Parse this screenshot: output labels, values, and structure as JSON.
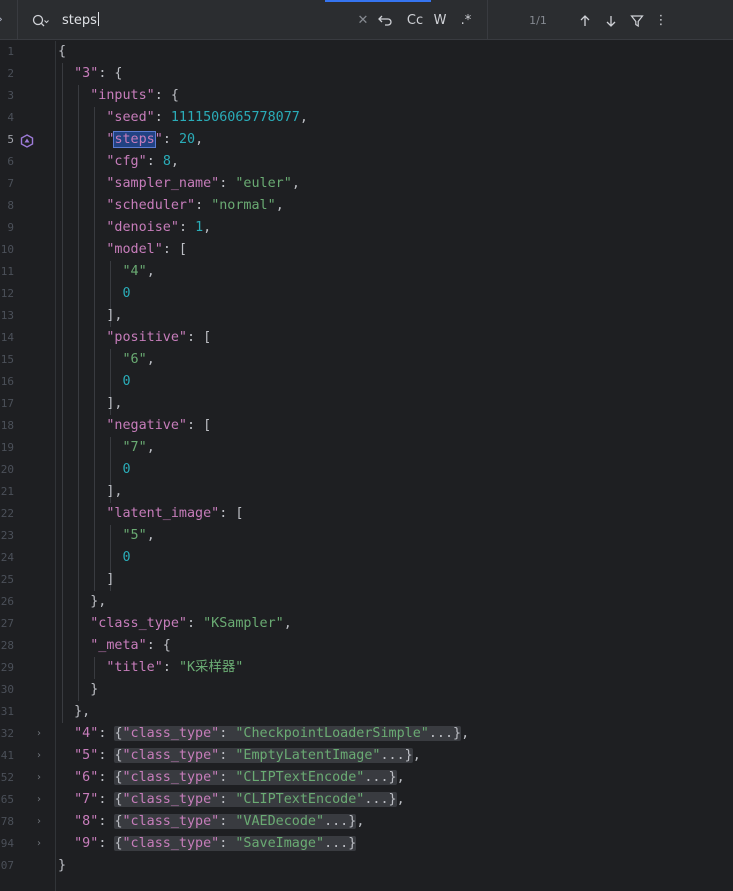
{
  "search": {
    "query": "steps",
    "case_label": "Cc",
    "word_label": "W",
    "regex_label": ".*",
    "result_count": "1/1",
    "icons": [
      "chevron-right-icon",
      "search-history-icon",
      "clear-icon",
      "replace-toggle-icon",
      "arrow-up-icon",
      "arrow-down-icon",
      "filter-icon",
      "more-options-icon"
    ]
  },
  "editor": {
    "lines": [
      {
        "n": "1",
        "fold": "",
        "html": "<span class='p'>{</span>"
      },
      {
        "n": "2",
        "fold": "",
        "html": "  <span class='k'>\"3\"</span><span class='p'>: {</span>"
      },
      {
        "n": "3",
        "fold": "",
        "html": "    <span class='k'>\"inputs\"</span><span class='p'>: {</span>"
      },
      {
        "n": "4",
        "fold": "",
        "html": "      <span class='k'>\"seed\"</span><span class='p'>: </span><span class='n'>1111506065778077</span><span class='p'>,</span>"
      },
      {
        "n": "5",
        "fold": "",
        "html": "      <span class='k'>\"<span class='hl'>steps</span>\"</span><span class='p'>: </span><span class='n'>20</span><span class='p'>,</span>",
        "current": true
      },
      {
        "n": "6",
        "fold": "",
        "html": "      <span class='k'>\"cfg\"</span><span class='p'>: </span><span class='n'>8</span><span class='p'>,</span>"
      },
      {
        "n": "7",
        "fold": "",
        "html": "      <span class='k'>\"sampler_name\"</span><span class='p'>: </span><span class='s'>\"euler\"</span><span class='p'>,</span>"
      },
      {
        "n": "8",
        "fold": "",
        "html": "      <span class='k'>\"scheduler\"</span><span class='p'>: </span><span class='s'>\"normal\"</span><span class='p'>,</span>"
      },
      {
        "n": "9",
        "fold": "",
        "html": "      <span class='k'>\"denoise\"</span><span class='p'>: </span><span class='n'>1</span><span class='p'>,</span>"
      },
      {
        "n": "10",
        "fold": "",
        "html": "      <span class='k'>\"model\"</span><span class='p'>: [</span>"
      },
      {
        "n": "11",
        "fold": "",
        "html": "        <span class='s'>\"4\"</span><span class='p'>,</span>"
      },
      {
        "n": "12",
        "fold": "",
        "html": "        <span class='n'>0</span>"
      },
      {
        "n": "13",
        "fold": "",
        "html": "      <span class='p'>],</span>"
      },
      {
        "n": "14",
        "fold": "",
        "html": "      <span class='k'>\"positive\"</span><span class='p'>: [</span>"
      },
      {
        "n": "15",
        "fold": "",
        "html": "        <span class='s'>\"6\"</span><span class='p'>,</span>"
      },
      {
        "n": "16",
        "fold": "",
        "html": "        <span class='n'>0</span>"
      },
      {
        "n": "17",
        "fold": "",
        "html": "      <span class='p'>],</span>"
      },
      {
        "n": "18",
        "fold": "",
        "html": "      <span class='k'>\"negative\"</span><span class='p'>: [</span>"
      },
      {
        "n": "19",
        "fold": "",
        "html": "        <span class='s'>\"7\"</span><span class='p'>,</span>"
      },
      {
        "n": "20",
        "fold": "",
        "html": "        <span class='n'>0</span>"
      },
      {
        "n": "21",
        "fold": "",
        "html": "      <span class='p'>],</span>"
      },
      {
        "n": "22",
        "fold": "",
        "html": "      <span class='k'>\"latent_image\"</span><span class='p'>: [</span>"
      },
      {
        "n": "23",
        "fold": "",
        "html": "        <span class='s'>\"5\"</span><span class='p'>,</span>"
      },
      {
        "n": "24",
        "fold": "",
        "html": "        <span class='n'>0</span>"
      },
      {
        "n": "25",
        "fold": "",
        "html": "      <span class='p'>]</span>"
      },
      {
        "n": "26",
        "fold": "",
        "html": "    <span class='p'>},</span>"
      },
      {
        "n": "27",
        "fold": "",
        "html": "    <span class='k'>\"class_type\"</span><span class='p'>: </span><span class='s'>\"KSampler\"</span><span class='p'>,</span>"
      },
      {
        "n": "28",
        "fold": "",
        "html": "    <span class='k'>\"_meta\"</span><span class='p'>: {</span>"
      },
      {
        "n": "29",
        "fold": "",
        "html": "      <span class='k'>\"title\"</span><span class='p'>: </span><span class='s'>\"K采样器\"</span>"
      },
      {
        "n": "30",
        "fold": "",
        "html": "    <span class='p'>}</span>"
      },
      {
        "n": "31",
        "fold": "",
        "html": "  <span class='p'>},</span>"
      },
      {
        "n": "32",
        "fold": "›",
        "html": "  <span class='k'>\"4\"</span><span class='p'>: </span><span class='fold-box'><span class='p'>{</span><span class='k2'>\"class_type\"</span><span class='p'>: </span><span class='s2'>\"CheckpointLoaderSimple\"</span><span class='p'>...}</span></span><span class='p'>,</span>"
      },
      {
        "n": "41",
        "fold": "›",
        "html": "  <span class='k'>\"5\"</span><span class='p'>: </span><span class='fold-box'><span class='p'>{</span><span class='k2'>\"class_type\"</span><span class='p'>: </span><span class='s2'>\"EmptyLatentImage\"</span><span class='p'>...}</span></span><span class='p'>,</span>"
      },
      {
        "n": "52",
        "fold": "›",
        "html": "  <span class='k'>\"6\"</span><span class='p'>: </span><span class='fold-box'><span class='p'>{</span><span class='k2'>\"class_type\"</span><span class='p'>: </span><span class='s2'>\"CLIPTextEncode\"</span><span class='p'>...}</span></span><span class='p'>,</span>"
      },
      {
        "n": "65",
        "fold": "›",
        "html": "  <span class='k'>\"7\"</span><span class='p'>: </span><span class='fold-box'><span class='p'>{</span><span class='k2'>\"class_type\"</span><span class='p'>: </span><span class='s2'>\"CLIPTextEncode\"</span><span class='p'>...}</span></span><span class='p'>,</span>"
      },
      {
        "n": "78",
        "fold": "›",
        "html": "  <span class='k'>\"8\"</span><span class='p'>: </span><span class='fold-box'><span class='p'>{</span><span class='k2'>\"class_type\"</span><span class='p'>: </span><span class='s2'>\"VAEDecode\"</span><span class='p'>...}</span></span><span class='p'>,</span>"
      },
      {
        "n": "94",
        "fold": "›",
        "html": "  <span class='k'>\"9\"</span><span class='p'>: </span><span class='fold-box'><span class='p'>{</span><span class='k2'>\"class_type\"</span><span class='p'>: </span><span class='s2'>\"SaveImage\"</span><span class='p'>...}</span></span>"
      },
      {
        "n": "107",
        "fold": "",
        "html": "<span class='p'>}</span>"
      }
    ]
  }
}
